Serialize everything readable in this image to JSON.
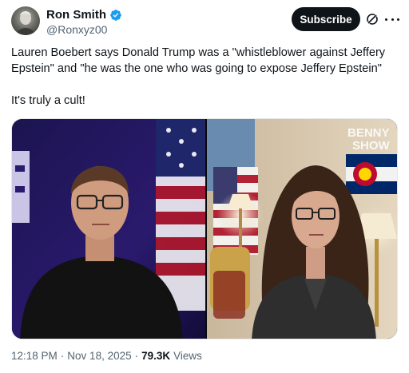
{
  "author": {
    "display_name": "Ron Smith",
    "handle": "@Ronxyz00",
    "verified": true
  },
  "actions": {
    "subscribe_label": "Subscribe",
    "grok_icon": "grok-icon",
    "more_icon": "more-icon"
  },
  "tweet": {
    "line1": "Lauren Boebert says Donald Trump was a \"whistleblower against Jeffery",
    "line2": "Epstein\" and \"he was the one who was going to expose Jeffery Epstein\"",
    "line3": "It's truly a cult!"
  },
  "media": {
    "watermark_line1": "BENNY",
    "watermark_line2": "SHOW"
  },
  "meta": {
    "time": "12:18 PM",
    "sep1": "·",
    "date": "Nov 18, 2025",
    "sep2": "·",
    "views_count": "79.3K",
    "views_label": "Views"
  },
  "colors": {
    "verified_blue": "#1d9bf0",
    "text_primary": "#0f1419",
    "text_secondary": "#536471"
  }
}
